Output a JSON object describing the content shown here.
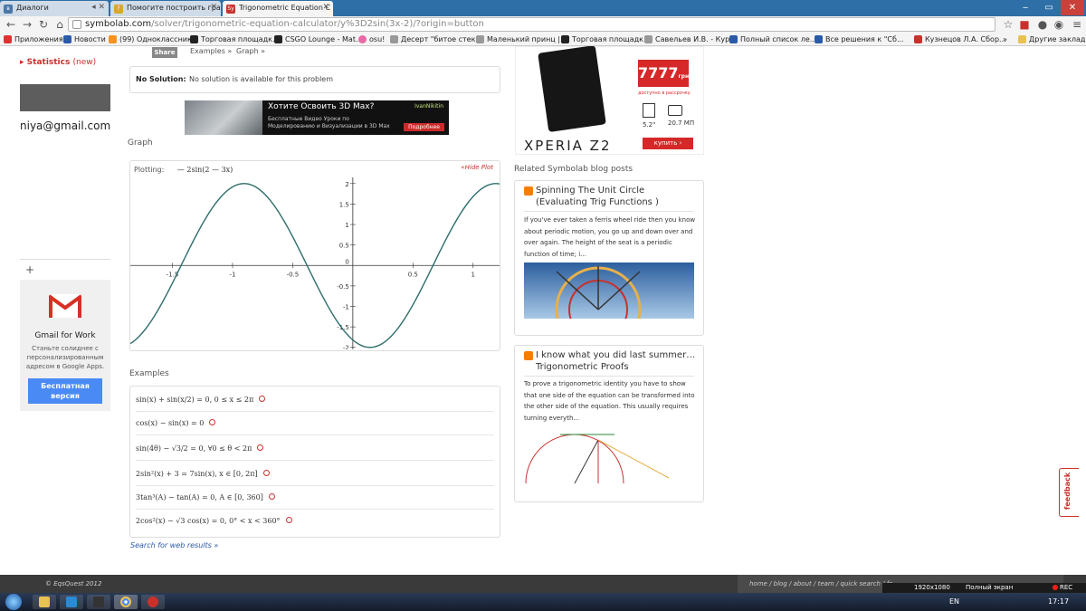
{
  "browser": {
    "tabs": [
      {
        "label": "Диалоги",
        "active": false
      },
      {
        "label": "Помогите построить гра",
        "active": false
      },
      {
        "label": "Trigonometric Equation C",
        "active": true
      }
    ],
    "url_host": "symbolab.com",
    "url_path": "/solver/trigonometric-equation-calculator/y%3D2sin(3x-2)/?origin=button",
    "bookmarks": [
      "Приложения",
      "Новости",
      "(99) Одноклассники",
      "Торговая площадк...",
      "CSGO Lounge - Mat...",
      "osu!",
      "Десерт \"битое стек...",
      "Маленький принц |...",
      "Торговая площадк...",
      "Савельев И.В. - Кур...",
      "Полный список ле...",
      "Все решения к \"Сб...",
      "Кузнецов Л.А. Сбор...",
      "»",
      "Другие закладки"
    ]
  },
  "sidebar": {
    "statistics_label": "Statistics",
    "statistics_new": "(new)",
    "email_fragment": "niya@gmail.com",
    "plus": "+",
    "gmail_ad": {
      "title": "Gmail for Work",
      "text": "Станьте солиднее с персонализированным адресом в Google Apps.",
      "button": "Бесплатная версия"
    }
  },
  "toolbar": {
    "share_label": "Share",
    "examples_crumb": "Examples »",
    "graph_crumb": "Graph »"
  },
  "solution": {
    "label": "No Solution:",
    "text": "No solution is available for this problem"
  },
  "banner_ad": {
    "title": "Хотите Освоить 3D Max?",
    "body": "Бесплатные Видео Уроки по Моделированию и Визуализации в 3D Max",
    "brand": "IvanNikitin",
    "button": "Подробнее"
  },
  "graph": {
    "section_title": "Graph",
    "plotting_label": "Plotting:",
    "function": "— 2sin(2 — 3x)",
    "hide_label": "«Hide Plot"
  },
  "chart_data": {
    "type": "line",
    "function": "y = -2sin(2 - 3x)",
    "xlim": [
      -1.85,
      1.22
    ],
    "ylim": [
      -2.05,
      2.15
    ],
    "x_ticks": [
      -1.5,
      -1,
      -0.5,
      0,
      0.5,
      1
    ],
    "y_ticks": [
      -2,
      -1.5,
      -1,
      -0.5,
      0,
      0.5,
      1,
      1.5,
      2
    ],
    "x_tick_labels": [
      "-1.5",
      "-1",
      "-0.5",
      "0",
      "0.5",
      "1"
    ],
    "y_tick_labels": [
      "-2",
      "-1.5",
      "-1",
      "-0.5",
      "0",
      "0.5",
      "1",
      "1.5",
      "2"
    ],
    "line_color": "#2e6e6a"
  },
  "examples": {
    "section_title": "Examples",
    "items": [
      "sin(x) + sin(x/2) = 0, 0 ≤ x ≤ 2π",
      "cos(x) − sin(x) = 0",
      "sin(4θ) − √3/2 = 0, ∀0 ≤ θ < 2π",
      "2sin²(x) + 3 = 7sin(x), x ∈ [0, 2π]",
      "3tan³(A) − tan(A) = 0, A ∈ [0, 360]",
      "2cos²(x) − √3 cos(x) = 0, 0° < x < 360°"
    ],
    "search_web": "Search for web results »"
  },
  "phone_ad": {
    "price": "7777",
    "price_unit": "грн",
    "installment": "доступно в рассрочку",
    "screen": "5.2\"",
    "camera": "20.7 МП",
    "brand": "XPERIA Z2",
    "buy": "купить ›"
  },
  "blog": {
    "section_title": "Related Symbolab blog posts",
    "posts": [
      {
        "title": "Spinning The Unit Circle (Evaluating Trig Functions )",
        "text": "If you've ever taken a ferris wheel ride then you know about periodic motion, you go up and down over and over again. The height of the seat is a periodic function of time; i..."
      },
      {
        "title": "I know what you did last summer…Trigonometric Proofs",
        "text": "To prove a trigonometric identity you have to show that one side of the equation can be transformed into the other side of the equation. This usually requires turning everyth..."
      }
    ]
  },
  "feedback_label": "feedback",
  "footer": {
    "copyright": "© EqsQuest 2012",
    "links": "home / blog / about / team / quick search / fe..."
  },
  "recorder": {
    "resolution": "1920x1080",
    "mode": "Полный экран",
    "rec": "REC"
  },
  "taskbar": {
    "lang": "EN",
    "time": "17:17"
  }
}
